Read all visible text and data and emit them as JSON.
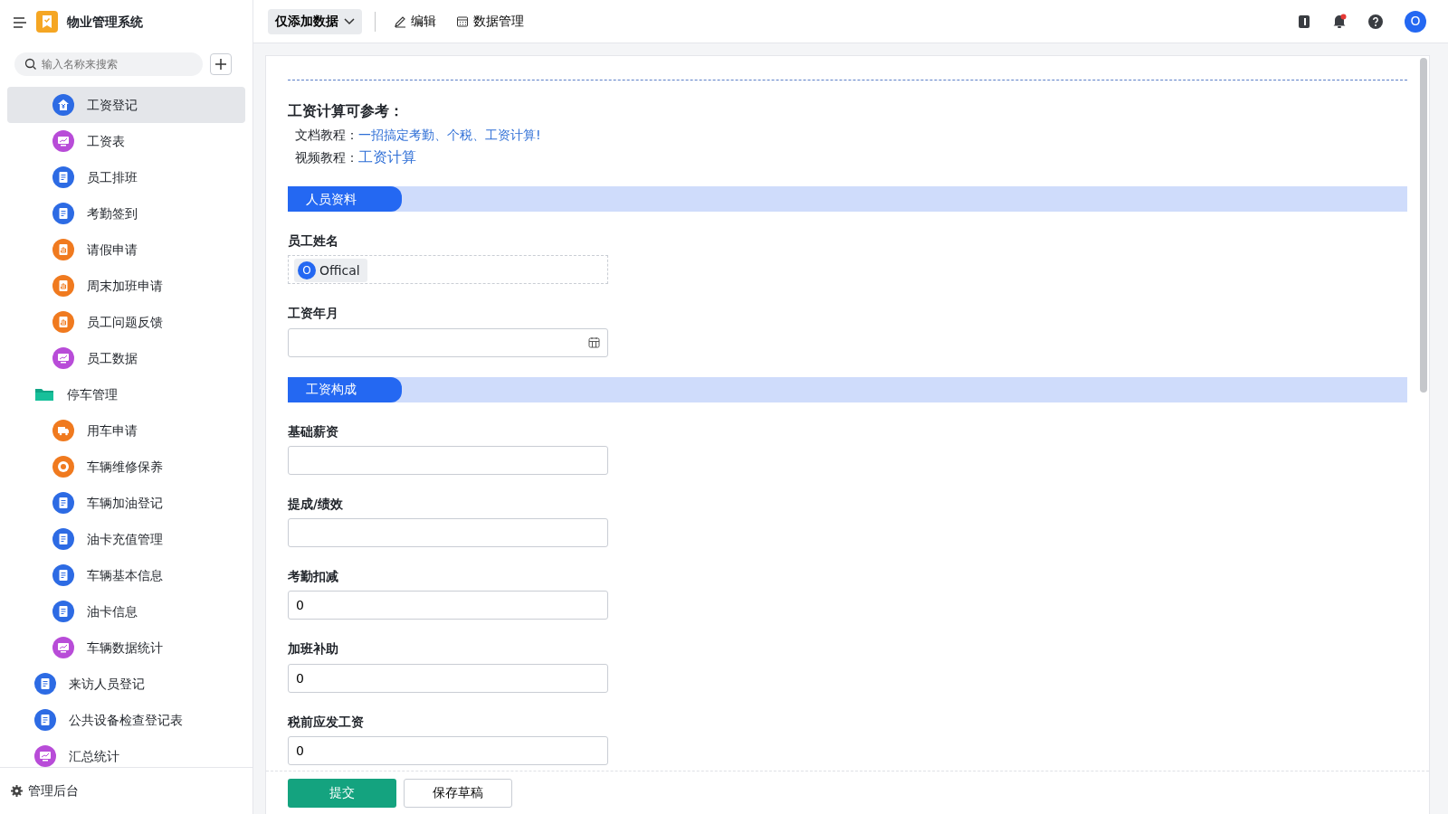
{
  "app": {
    "title": "物业管理系统"
  },
  "sidebar": {
    "search": {
      "placeholder": "输入名称来搜索"
    },
    "items": [
      {
        "children": [
          {
            "label": "工资登记",
            "kind": "salary",
            "selected": true
          },
          {
            "label": "工资表",
            "kind": "report",
            "selected": false
          },
          {
            "label": "员工排班",
            "kind": "form",
            "selected": false
          },
          {
            "label": "考勤签到",
            "kind": "form",
            "selected": false
          },
          {
            "label": "请假申请",
            "kind": "approval",
            "selected": false
          },
          {
            "label": "周末加班申请",
            "kind": "approval",
            "selected": false
          },
          {
            "label": "员工问题反馈",
            "kind": "approval",
            "selected": false
          },
          {
            "label": "员工数据",
            "kind": "report",
            "selected": false
          }
        ]
      },
      {
        "label": "停车管理",
        "kind": "folder",
        "selected": false,
        "children": [
          {
            "label": "用车申请",
            "kind": "truck",
            "selected": false
          },
          {
            "label": "车辆维修保养",
            "kind": "repair",
            "selected": false
          },
          {
            "label": "车辆加油登记",
            "kind": "form",
            "selected": false
          },
          {
            "label": "油卡充值管理",
            "kind": "form",
            "selected": false
          },
          {
            "label": "车辆基本信息",
            "kind": "form",
            "selected": false
          },
          {
            "label": "油卡信息",
            "kind": "form",
            "selected": false
          },
          {
            "label": "车辆数据统计",
            "kind": "report",
            "selected": false
          }
        ]
      },
      {
        "label": "来访人员登记",
        "kind": "form",
        "selected": false
      },
      {
        "label": "公共设备检查登记表",
        "kind": "form",
        "selected": false
      },
      {
        "label": "汇总统计",
        "kind": "report",
        "selected": false
      }
    ],
    "footer": "管理后台"
  },
  "toolbar": {
    "mode": "仅添加数据",
    "edit": "编辑",
    "data": "数据管理",
    "avatar": "O",
    "notification_dot": true
  },
  "form": {
    "heading": "工资计算可参考：",
    "links": [
      {
        "label": "文档教程：",
        "link": "一招搞定考勤、个税、工资计算!"
      },
      {
        "label": "视频教程：",
        "link": "工资计算"
      }
    ],
    "fields": [
      {
        "kind": "section",
        "label": "人员资料"
      },
      {
        "kind": "member",
        "label": "员工姓名",
        "avatar": "O",
        "value": "Offical"
      },
      {
        "kind": "date",
        "label": "工资年月"
      },
      {
        "kind": "section",
        "label": "工资构成"
      },
      {
        "kind": "text",
        "label": "基础薪资"
      },
      {
        "kind": "text",
        "label": "提成/绩效"
      },
      {
        "kind": "text",
        "label": "考勤扣减",
        "value": "0"
      },
      {
        "kind": "text",
        "label": "加班补助",
        "value": "0"
      },
      {
        "kind": "text",
        "label": "税前应发工资",
        "value": "0"
      }
    ],
    "buttons": {
      "submit": "提交",
      "draft": "保存草稿"
    }
  }
}
